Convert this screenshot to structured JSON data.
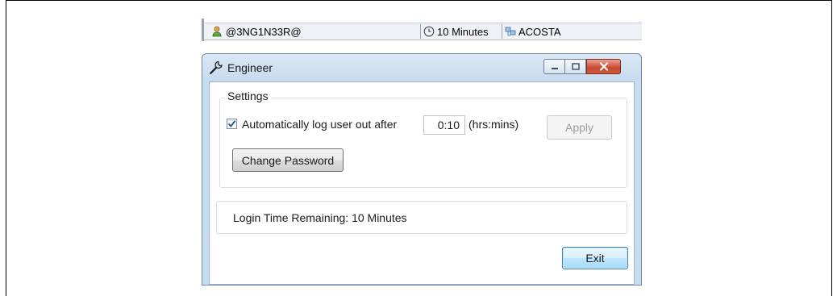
{
  "statusbar": {
    "user": "@3NG1N33R@",
    "timer": "10 Minutes",
    "machine": "ACOSTA"
  },
  "window": {
    "title": "Engineer",
    "icon": "wrench-icon"
  },
  "settings": {
    "group_title": "Settings",
    "auto_logout_checked": true,
    "auto_logout_label": "Automatically log user out after",
    "timeout_value": "0:10",
    "timeout_unit": "(hrs:mins)",
    "apply_label": "Apply",
    "change_password_label": "Change Password"
  },
  "status": {
    "login_time_remaining": "Login Time Remaining:  10 Minutes"
  },
  "footer": {
    "exit_label": "Exit"
  },
  "colors": {
    "titlebar": "#c9dbee",
    "close_button": "#c8482f",
    "exit_button": "#bee6fd"
  }
}
